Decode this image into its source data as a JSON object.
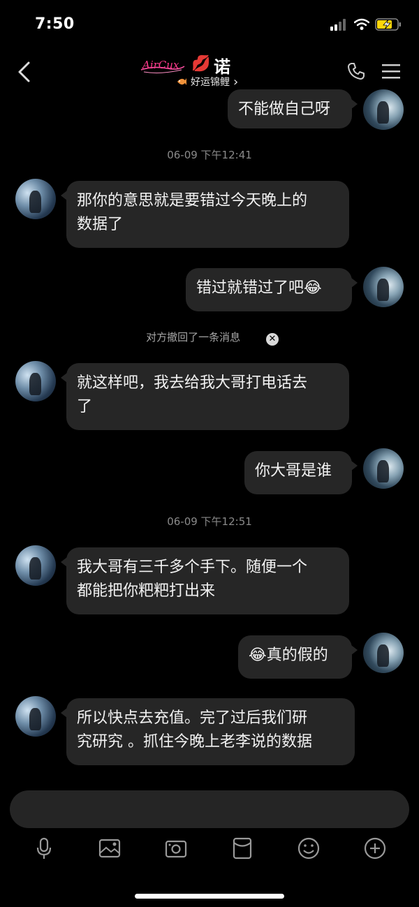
{
  "status_bar": {
    "time": "7:50"
  },
  "header": {
    "logo_text": "AirCux",
    "contact_name": "诺",
    "badge": "好运锦鲤",
    "badge_chevron": "›"
  },
  "messages": {
    "m1": "不能做自己呀",
    "ts1": "06-09 下午12:41",
    "m2": "那你的意思就是要错过今天晚上的\n数据了",
    "m3": "错过就错过了吧😂",
    "recall_notice": "对方撤回了一条消息",
    "m4": "就这样吧，我去给我大哥打电话去\n了",
    "m5": "你大哥是谁",
    "ts2": "06-09 下午12:51",
    "m6": "我大哥有三千多个手下。随便一个\n都能把你粑粑打出来",
    "m7": "😂真的假的",
    "m8": "所以快点去充值。完了过后我们研\n究研究 。抓住今晚上老李说的数据"
  },
  "icons": {
    "back": "chevron-left-icon",
    "call": "phone-icon",
    "menu": "hamburger-icon",
    "toolbar": [
      "microphone-icon",
      "image-icon",
      "camera-icon",
      "red-packet-icon",
      "emoji-icon",
      "plus-icon"
    ]
  },
  "colors": {
    "bubble": "#262626",
    "background": "#000000",
    "battery_fill": "#ffd60a",
    "kiss_red": "#e0202c"
  }
}
